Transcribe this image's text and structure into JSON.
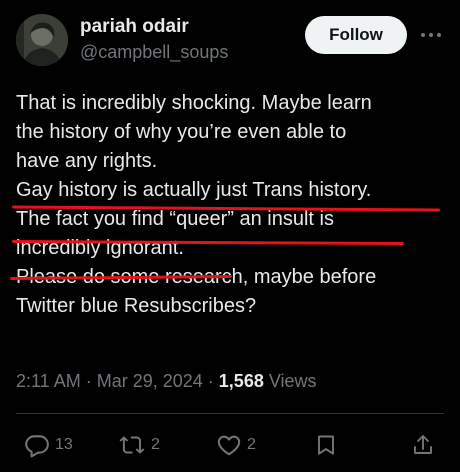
{
  "user": {
    "display_name": "pariah odair",
    "handle": "@campbell_soups"
  },
  "follow_label": "Follow",
  "post": {
    "lines": [
      "That is incredibly shocking. Maybe learn",
      "the history of why you’re even able to",
      "have any rights.",
      "Gay history is actually just Trans history.",
      "The fact you find “queer” an insult is",
      "incredibly ignorant.",
      "Please do some research, maybe before",
      "Twitter blue Resubscribes?"
    ]
  },
  "meta": {
    "time": "2:11 AM",
    "sep1": " · ",
    "date": "Mar 29, 2024",
    "sep2": " · ",
    "views_count": "1,568",
    "views_label": " Views"
  },
  "actions": {
    "replies": "13",
    "reposts": "2",
    "likes": "2"
  },
  "colors": {
    "background": "#000000",
    "text": "#e7e9ea",
    "secondary": "#71767b",
    "underline": "#e5121b"
  },
  "icons": [
    "more-icon",
    "reply-icon",
    "repost-icon",
    "like-icon",
    "bookmark-icon",
    "share-icon"
  ]
}
